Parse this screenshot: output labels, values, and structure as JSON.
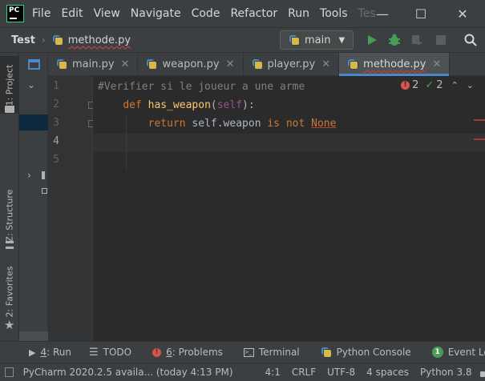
{
  "app": {
    "logo_text": "PC",
    "menu": [
      "File",
      "Edit",
      "View",
      "Navigate",
      "Code",
      "Refactor",
      "Run",
      "Tools",
      "Tes"
    ]
  },
  "navbar": {
    "project": "Test",
    "file": "methode.py",
    "branch": "main"
  },
  "left_stripe": {
    "project": "1: Project",
    "structure": "Z: Structure",
    "favorites": "2: Favorites"
  },
  "tabs": [
    {
      "label": "main.py"
    },
    {
      "label": "weapon.py"
    },
    {
      "label": "player.py"
    },
    {
      "label": "methode.py",
      "active": true
    }
  ],
  "editor": {
    "line_numbers": [
      "1",
      "2",
      "3",
      "4",
      "5"
    ],
    "comment": "#Verifier si le joueur a une arme",
    "def_kw": "def",
    "func_name": "has_weapon",
    "params": "(",
    "self_param": "self",
    "params_end": "):",
    "return_kw": "return",
    "self_ref": "self",
    "attr": ".weapon ",
    "is_not": "is not",
    "none_kw": "None",
    "errors": "2",
    "weak_warnings": "2"
  },
  "toolwindows": [
    {
      "icon": "run-icon",
      "mnemonic": "4",
      "label": ": Run"
    },
    {
      "icon": "todo-icon",
      "mnemonic": "",
      "label": "TODO"
    },
    {
      "icon": "problems-icon",
      "mnemonic": "6",
      "label": ": Problems"
    },
    {
      "icon": "terminal-icon",
      "mnemonic": "",
      "label": "Terminal"
    },
    {
      "icon": "python-console-icon",
      "mnemonic": "",
      "label": "Python Console"
    },
    {
      "icon": "event-log-icon",
      "mnemonic": "",
      "label": "Event Log",
      "badge": "1"
    }
  ],
  "status": {
    "message": "PyCharm 2020.2.5 availa... (today 4:13 PM)",
    "position": "4:1",
    "line_sep": "CRLF",
    "encoding": "UTF-8",
    "indent": "4 spaces",
    "interpreter": "Python 3.8"
  },
  "colors": {
    "accent": "#4a88c7",
    "run_green": "#499c54",
    "error_red": "#d9534f",
    "keyword": "#cc7832",
    "function": "#ffc66d",
    "comment": "#808080"
  }
}
